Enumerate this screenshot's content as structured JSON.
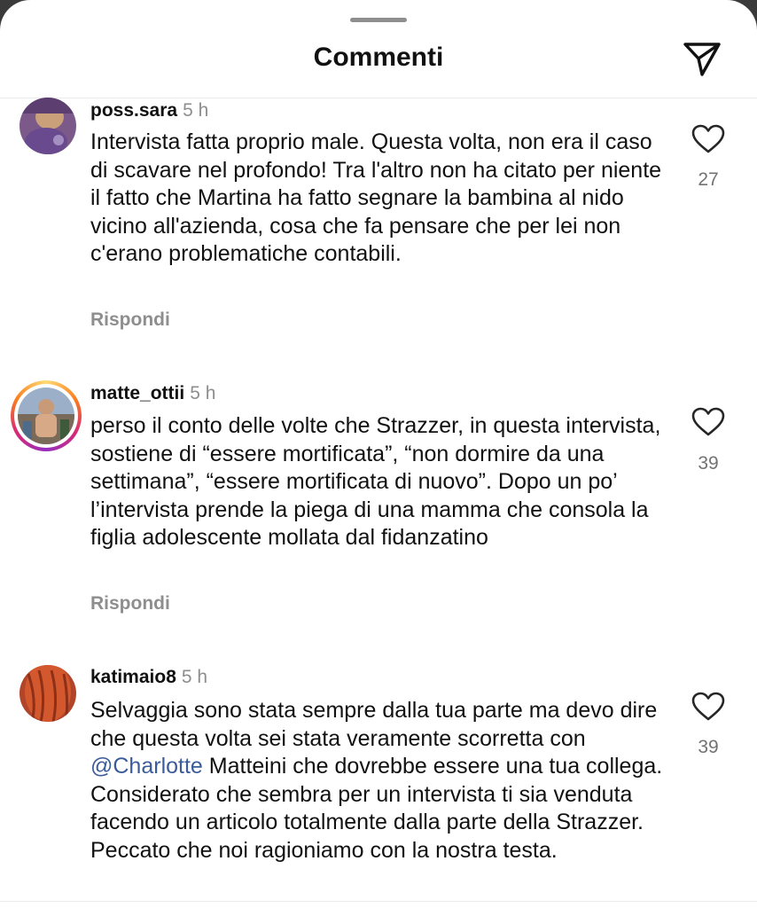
{
  "header": {
    "title": "Commenti",
    "share_icon": "paper-plane-icon"
  },
  "comments": [
    {
      "username": "poss.sara",
      "time": "5 h",
      "text": "Intervista fatta proprio male. Questa volta, non era il caso di scavare nel profondo! Tra l'altro non ha citato per niente il fatto che Martina ha fatto segnare la bambina al nido vicino all'azienda, cosa che fa pensare che per lei non c'erano problematiche contabili.",
      "reply_label": "Rispondi",
      "likes": "27",
      "like_icon": "heart-outline-icon",
      "story_ring": false
    },
    {
      "username": "matte_ottii",
      "time": "5 h",
      "text": "perso il conto delle volte che Strazzer, in questa intervista, sostiene di “essere mortificata”, “non dormire da una settimana”, “essere mortificata di nuovo”. Dopo un po’ l’intervista prende la piega di una mamma che consola la figlia adolescente mollata dal fidanzatino",
      "reply_label": "Rispondi",
      "likes": "39",
      "like_icon": "heart-outline-icon",
      "story_ring": true
    },
    {
      "username": "katimaio8",
      "time": "5 h",
      "text_before_mention": "Selvaggia sono stata sempre dalla tua parte ma devo dire che questa volta sei stata veramente scorretta con ",
      "mention": "@Charlotte",
      "text_after_mention": " Matteini che dovrebbe essere una tua collega. Considerato che sembra per un intervista ti sia venduta facendo un articolo totalmente dalla parte della Strazzer. Peccato che noi ragioniamo con la nostra testa.",
      "likes": "39",
      "like_icon": "heart-outline-icon",
      "story_ring": false
    }
  ],
  "colors": {
    "text": "#111111",
    "secondary": "#8e8e8e",
    "mention": "#3b5c9a",
    "divider": "#ececec"
  }
}
